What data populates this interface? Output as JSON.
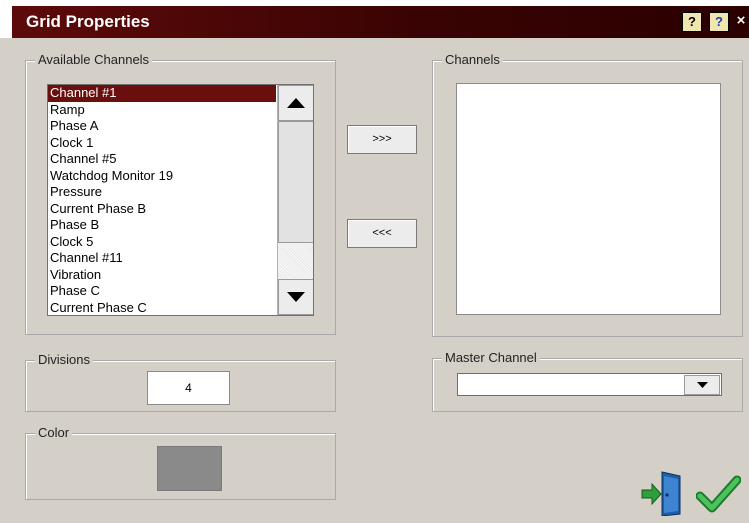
{
  "window": {
    "title": "Grid Properties",
    "help_context_label": "?",
    "help_label": "?",
    "close_label": "×"
  },
  "available_channels": {
    "label": "Available Channels",
    "items": [
      "Channel #1",
      "Ramp",
      "Phase A",
      "Clock 1",
      "Channel #5",
      "Watchdog Monitor 19",
      "Pressure",
      "Current Phase B",
      "Phase B",
      "Clock 5",
      "Channel #11",
      "Vibration",
      "Phase C",
      "Current Phase C"
    ],
    "selected_index": 0
  },
  "buttons": {
    "add_label": ">>>",
    "remove_label": "<<<"
  },
  "channels": {
    "label": "Channels",
    "items": []
  },
  "divisions": {
    "label": "Divisions",
    "value": "4"
  },
  "master_channel": {
    "label": "Master Channel",
    "value": ""
  },
  "color": {
    "label": "Color",
    "swatch": "#8a8a8a"
  },
  "icons": {
    "exit": "exit-door-icon",
    "ok": "checkmark-icon"
  },
  "colors": {
    "title_bar": "#5e0a0a",
    "selection": "#6b0e0e",
    "ok_green": "#2ea043"
  }
}
